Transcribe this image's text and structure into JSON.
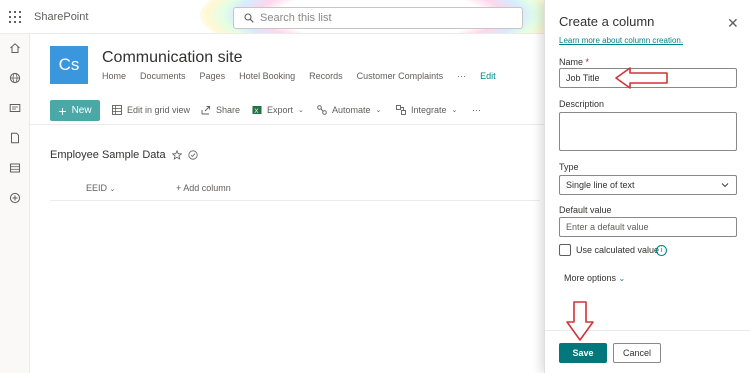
{
  "suite": {
    "brand": "SharePoint",
    "search_placeholder": "Search this list"
  },
  "rail_icons": [
    "home-icon",
    "globe-icon",
    "news-icon",
    "document-icon",
    "list-icon",
    "add-icon"
  ],
  "site": {
    "logo_initials": "Cs",
    "title": "Communication site",
    "nav": [
      "Home",
      "Documents",
      "Pages",
      "Hotel Booking",
      "Records",
      "Customer Complaints"
    ],
    "nav_more": "···",
    "nav_edit": "Edit"
  },
  "command_bar": {
    "new_label": "New",
    "edit_grid_label": "Edit in grid view",
    "share_label": "Share",
    "export_label": "Export",
    "automate_label": "Automate",
    "integrate_label": "Integrate",
    "more_label": "···"
  },
  "list": {
    "title": "Employee Sample Data",
    "columns": [
      "EEID"
    ],
    "add_column_label": "Add column"
  },
  "panel": {
    "title": "Create a column",
    "learn_more": "Learn more about column creation.",
    "name_label": "Name",
    "required_marker": "*",
    "name_value": "Job Title",
    "description_label": "Description",
    "type_label": "Type",
    "type_value": "Single line of text",
    "default_label": "Default value",
    "default_placeholder": "Enter a default value",
    "calculated_label": "Use calculated value",
    "calculated_checked": false,
    "more_options": "More options",
    "save_label": "Save",
    "cancel_label": "Cancel"
  },
  "colors": {
    "accent": "#038387",
    "primary_button": "#03787c",
    "new_button": "#4aa8a6",
    "logo": "#3a96dd",
    "annotation_arrow": "#d13438"
  }
}
